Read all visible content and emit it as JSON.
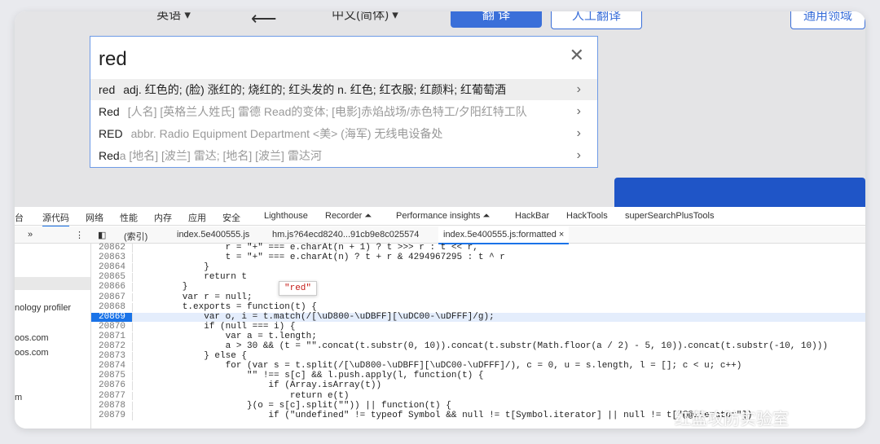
{
  "translate": {
    "source_lang": "英语",
    "swap_symbol": "⟵",
    "target_lang": "中文(简体)",
    "translate_button": "翻 译",
    "human_button": "人工翻译",
    "domain_button": "通用领域",
    "input_value": "red",
    "suggestions": [
      {
        "word": "red",
        "desc": "adj. 红色的; (脸) 涨红的; 烧红的; 红头发的 n. 红色; 红衣服; 红颜料; 红葡萄酒"
      },
      {
        "word": "Red",
        "desc": "[人名] [英格兰人姓氏] 雷德 Read的变体; [电影]赤焰战场/赤色特工/夕阳红特工队"
      },
      {
        "word": "RED",
        "desc": "abbr. Radio Equipment Department <美> (海军) 无线电设备处"
      },
      {
        "word": "Red",
        "desc": "a [地名] [波兰] 雷达; [地名] [波兰] 雷达河"
      }
    ]
  },
  "devtools": {
    "tabs": [
      "台",
      "源代码",
      "网络",
      "性能",
      "内存",
      "应用",
      "安全",
      "Lighthouse",
      "Recorder ⏶",
      "Performance insights ⏶",
      "HackBar",
      "HackTools",
      "superSearchPlusTools"
    ],
    "file_tabs": [
      "»",
      "⋮",
      "◧",
      "(索引)",
      "index.5e400555.js",
      "hm.js?64ecd8240...91cb9e8c025574",
      "index.5e400555.js:formatted ×"
    ],
    "sidebar_items": [
      "nology profiler",
      "oos.com",
      "oos.com",
      "m"
    ],
    "tooltip": "\"red\"",
    "code_lines": [
      {
        "n": "20862",
        "t": "                r = \"+\" === e.charAt(n + 1) ? t >>> r : t << r,"
      },
      {
        "n": "20863",
        "t": "                t = \"+\" === e.charAt(n) ? t + r & 4294967295 : t ^ r"
      },
      {
        "n": "20864",
        "t": "            }"
      },
      {
        "n": "20865",
        "t": "            return t"
      },
      {
        "n": "20866",
        "t": "        }"
      },
      {
        "n": "20867",
        "t": "        var r = null;"
      },
      {
        "n": "20868",
        "t": "        t.exports = function(t) {"
      },
      {
        "n": "20869",
        "t": "            var o, i = t.match(/[\\uD800-\\uDBFF][\\uDC00-\\uDFFF]/g);"
      },
      {
        "n": "20870",
        "t": "            if (null === i) {"
      },
      {
        "n": "20871",
        "t": "                var a = t.length;"
      },
      {
        "n": "20872",
        "t": "                a > 30 && (t = \"\".concat(t.substr(0, 10)).concat(t.substr(Math.floor(a / 2) - 5, 10)).concat(t.substr(-10, 10)))"
      },
      {
        "n": "20873",
        "t": "            } else {"
      },
      {
        "n": "20874",
        "t": "                for (var s = t.split(/[\\uD800-\\uDBFF][\\uDC00-\\uDFFF]/), c = 0, u = s.length, l = []; c < u; c++)"
      },
      {
        "n": "20875",
        "t": "                    \"\" !== s[c] && l.push.apply(l, function(t) {"
      },
      {
        "n": "20876",
        "t": "                        if (Array.isArray(t))"
      },
      {
        "n": "20877",
        "t": "                            return e(t)"
      },
      {
        "n": "20878",
        "t": "                    }(o = s[c].split(\"\")) || function(t) {"
      },
      {
        "n": "20879",
        "t": "                        if (\"undefined\" != typeof Symbol && null != t[Symbol.iterator] || null != t[\"@@iterator\"])"
      }
    ]
  },
  "watermark": "红蓝攻防实验室"
}
